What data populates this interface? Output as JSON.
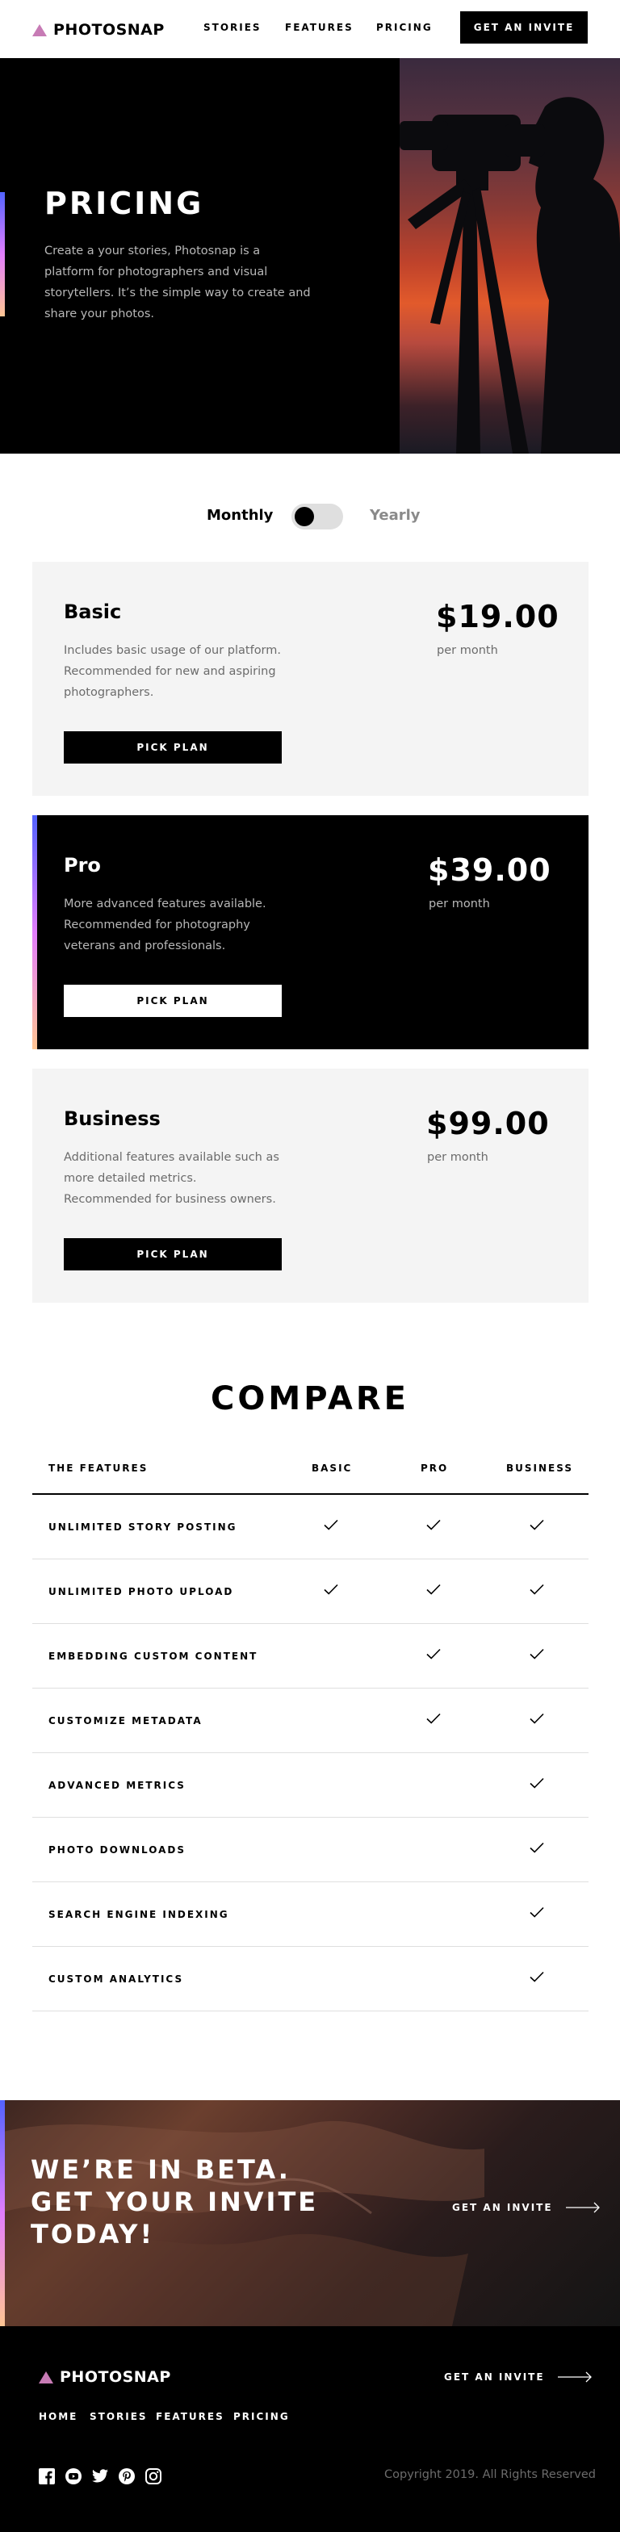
{
  "header": {
    "logo": "PHOTOSNAP",
    "nav": [
      "STORIES",
      "FEATURES",
      "PRICING"
    ],
    "cta": "GET AN INVITE"
  },
  "hero": {
    "title": "PRICING",
    "text": "Create a your stories, Photosnap is a platform for photographers and visual storytellers. It’s the simple way to create and share your photos."
  },
  "billing": {
    "monthly": "Monthly",
    "yearly": "Yearly",
    "selected": "Monthly"
  },
  "plans": [
    {
      "name": "Basic",
      "desc": "Includes basic usage of our platform. Recommended for new and aspiring photographers.",
      "price": "$19.00",
      "period": "per month",
      "button": "PICK PLAN"
    },
    {
      "name": "Pro",
      "desc": "More advanced features available. Recommended for photography veterans and professionals.",
      "price": "$39.00",
      "period": "per month",
      "button": "PICK PLAN"
    },
    {
      "name": "Business",
      "desc": "Additional features available such as more detailed metrics. Recommended for business owners.",
      "price": "$99.00",
      "period": "per month",
      "button": "PICK PLAN"
    }
  ],
  "compare": {
    "title": "COMPARE",
    "headers": [
      "THE FEATURES",
      "BASIC",
      "PRO",
      "BUSINESS"
    ],
    "rows": [
      {
        "feature": "UNLIMITED STORY POSTING",
        "basic": true,
        "pro": true,
        "business": true
      },
      {
        "feature": "UNLIMITED PHOTO UPLOAD",
        "basic": true,
        "pro": true,
        "business": true
      },
      {
        "feature": "EMBEDDING CUSTOM CONTENT",
        "basic": false,
        "pro": true,
        "business": true
      },
      {
        "feature": "CUSTOMIZE METADATA",
        "basic": false,
        "pro": true,
        "business": true
      },
      {
        "feature": "ADVANCED METRICS",
        "basic": false,
        "pro": false,
        "business": true
      },
      {
        "feature": "PHOTO DOWNLOADS",
        "basic": false,
        "pro": false,
        "business": true
      },
      {
        "feature": "SEARCH ENGINE INDEXING",
        "basic": false,
        "pro": false,
        "business": true
      },
      {
        "feature": "CUSTOM ANALYTICS",
        "basic": false,
        "pro": false,
        "business": true
      }
    ]
  },
  "beta": {
    "title": "WE’RE IN BETA. GET YOUR INVITE TODAY!",
    "cta": "GET AN INVITE"
  },
  "footer": {
    "logo": "PHOTOSNAP",
    "nav": [
      "HOME",
      "STORIES",
      "FEATURES",
      "PRICING"
    ],
    "cta": "GET AN INVITE",
    "social": [
      "facebook-icon",
      "youtube-icon",
      "twitter-icon",
      "pinterest-icon",
      "instagram-icon"
    ],
    "copyright": "Copyright 2019. All Rights Reserved"
  },
  "colors": {
    "accent_gradient": [
      "#5263ff",
      "#e27efd",
      "#ffc593"
    ],
    "text_muted": "#6b6b6b",
    "card_bg": "#f4f4f4"
  }
}
